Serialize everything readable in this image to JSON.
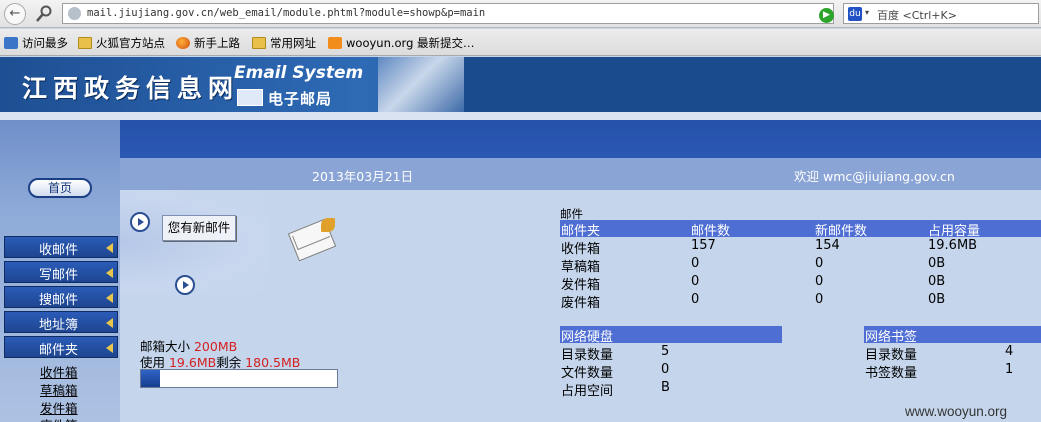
{
  "browser": {
    "back_glyph": "←",
    "url": "mail.jiujiang.gov.cn/web_email/module.phtml?module=showp&p=main",
    "go_glyph": "▶",
    "star_glyph": "☆",
    "chevron_glyph": "▾",
    "reload_glyph": "C",
    "search_engine": "百度",
    "search_placeholder": "<Ctrl+K>",
    "engine_glyph": "du",
    "search_drop_glyph": "▾"
  },
  "bookmarks": [
    {
      "label": "访问最多",
      "icon": "bookmark-icon"
    },
    {
      "label": "火狐官方站点",
      "icon": "folder-icon"
    },
    {
      "label": "新手上路",
      "icon": "firefox-icon"
    },
    {
      "label": "常用网址",
      "icon": "folder-icon"
    },
    {
      "label": "wooyun.org 最新提交…",
      "icon": "rss-icon"
    }
  ],
  "banner": {
    "site_title": "江西政务信息网",
    "email_system": "Email System",
    "mail_title": "电子邮局"
  },
  "header": {
    "date": "2013年03月21日",
    "welcome": "欢迎 wmc@jiujiang.gov.cn"
  },
  "menu": {
    "home": "首页",
    "items": [
      "收邮件",
      "写邮件",
      "搜邮件",
      "地址簿",
      "邮件夹"
    ],
    "sub_items": [
      "收件箱",
      "草稿箱",
      "发件箱",
      "废件箱"
    ]
  },
  "newmail": {
    "button_label": "您有新邮件"
  },
  "quota": {
    "size_label": "邮箱大小 ",
    "size_value": "200MB",
    "used_label": "使用 ",
    "used_value": "19.6MB",
    "remain_label": "剩余 ",
    "remain_value": "180.5MB",
    "used_fraction": 0.098
  },
  "mail_table": {
    "section_label": "邮件",
    "headers": [
      "邮件夹",
      "邮件数",
      "新邮件数",
      "占用容量"
    ],
    "rows": [
      [
        "收件箱",
        "157",
        "154",
        "19.6MB"
      ],
      [
        "草稿箱",
        "0",
        "0",
        "0B"
      ],
      [
        "发件箱",
        "0",
        "0",
        "0B"
      ],
      [
        "废件箱",
        "0",
        "0",
        "0B"
      ]
    ]
  },
  "netdisk": {
    "header": "网络硬盘",
    "rows": [
      [
        "目录数量",
        "5"
      ],
      [
        "文件数量",
        "0"
      ],
      [
        "占用空间",
        "B"
      ]
    ]
  },
  "netbookmark": {
    "header": "网络书签",
    "rows": [
      [
        "目录数量",
        "4"
      ],
      [
        "书签数量",
        "1"
      ]
    ]
  },
  "watermark": "www.wooyun.org"
}
